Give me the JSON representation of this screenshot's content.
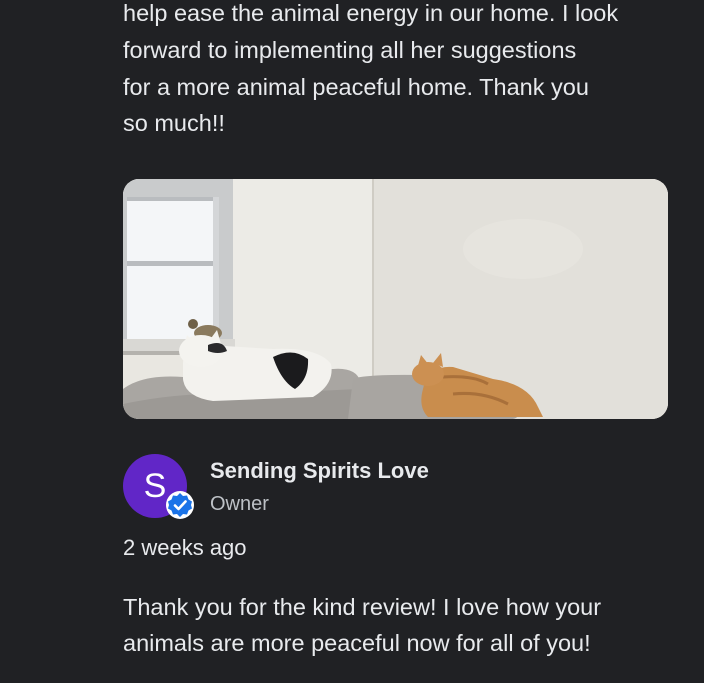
{
  "review": {
    "text_lines": [
      "help ease the animal energy in our home. I look",
      "forward to implementing all her suggestions",
      "for a more animal peaceful home. Thank you",
      "so much!!"
    ],
    "photo": {
      "subject": "two-cats-on-couch-photo"
    }
  },
  "owner_response": {
    "avatar_initial": "S",
    "avatar_color": "#6126c7",
    "verified_badge_color": "#1a73e8",
    "name": "Sending Spirits Love",
    "role": "Owner",
    "timestamp": "2 weeks ago",
    "reply_lines": [
      "Thank you for the kind review! I love how your",
      "animals are more peaceful now for all of you!"
    ]
  }
}
